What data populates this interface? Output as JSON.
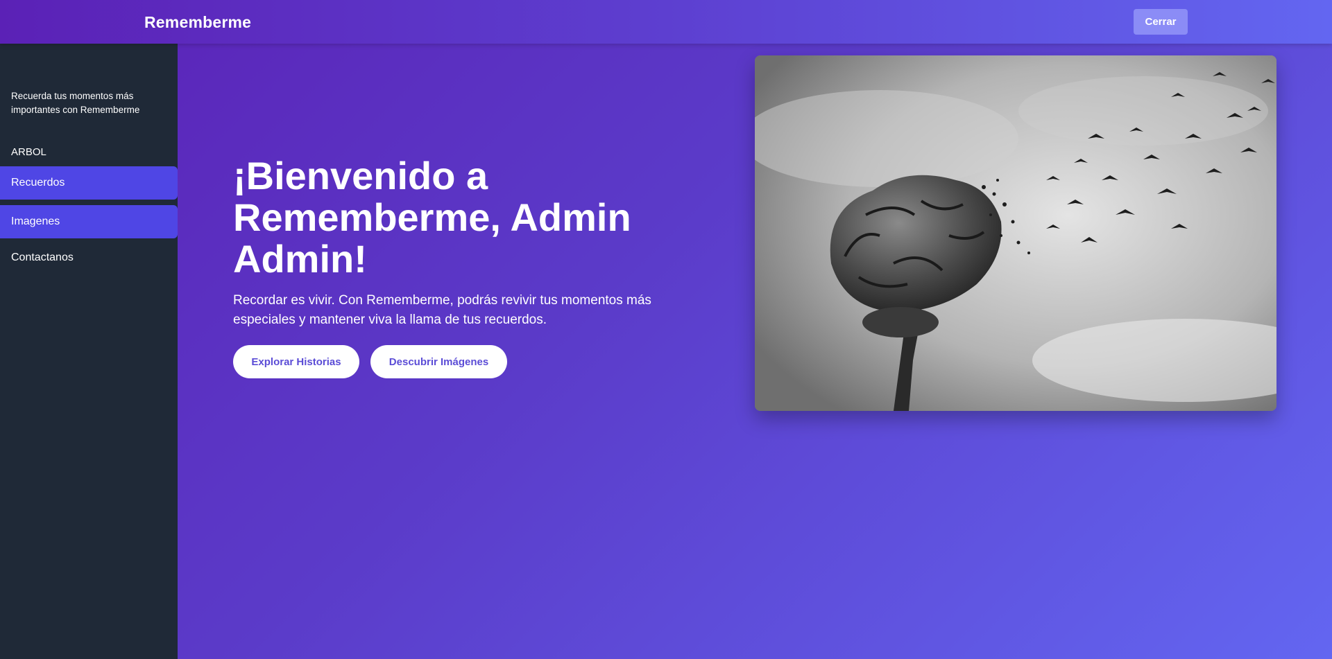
{
  "header": {
    "brand": "Rememberme",
    "close_label": "Cerrar"
  },
  "sidebar": {
    "tagline": "Recuerda tus momentos más importantes con Rememberme",
    "section_label": "ARBOL",
    "items": [
      {
        "label": "Recuerdos",
        "active": true
      },
      {
        "label": "Imagenes",
        "active": true
      },
      {
        "label": "Contactanos",
        "active": false
      }
    ]
  },
  "hero": {
    "title": "¡Bienvenido a Rememberme, Admin Admin!",
    "subtitle": "Recordar es vivir. Con Rememberme, podrás revivir tus momentos más especiales y mantener viva la llama de tus recuerdos.",
    "buttons": [
      {
        "label": "Explorar Historias"
      },
      {
        "label": "Descubrir Imágenes"
      }
    ],
    "image_icon": "brain-dissolving-into-birds-image"
  },
  "colors": {
    "accent": "#4f46e5",
    "sidebar_bg": "#1f2937",
    "gradient_start": "#5b21b6",
    "gradient_end": "#6366f1",
    "button_text": "#5b4cd6"
  }
}
